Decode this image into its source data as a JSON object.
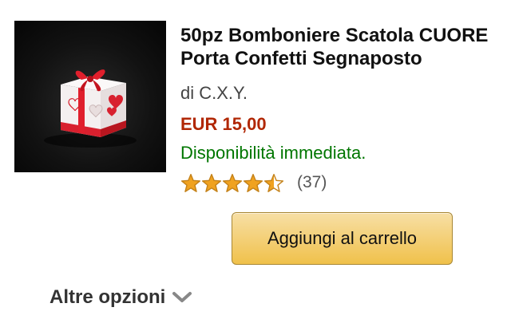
{
  "product": {
    "title": "50pz Bomboniere Scatola CUORE Porta Confetti Segnaposto",
    "byline": "di C.X.Y.",
    "price": "EUR 15,00",
    "availability": "Disponibilità immediata.",
    "rating": {
      "stars": 4.5,
      "max_stars": 5,
      "review_count": "(37)"
    },
    "image_icon": "gift-box-with-hearts"
  },
  "actions": {
    "add_to_cart_label": "Aggiungi al carrello",
    "more_options_label": "Altre opzioni"
  },
  "colors": {
    "price": "#b12704",
    "availability": "#007600",
    "star": "#f0a220",
    "button": "#f0c14b"
  }
}
